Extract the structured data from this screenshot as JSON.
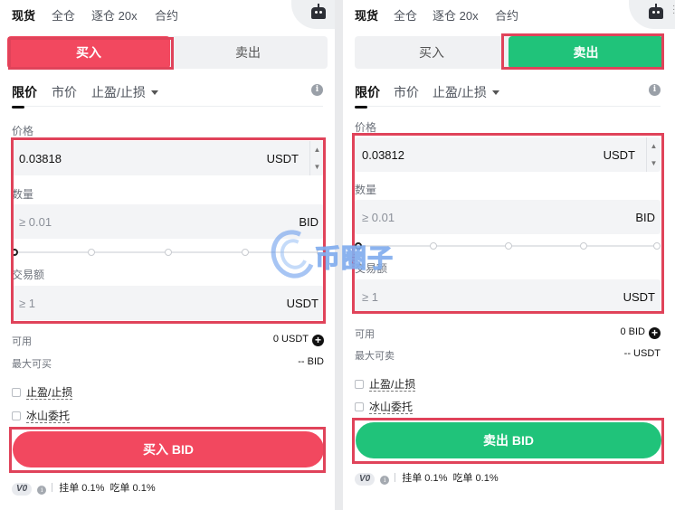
{
  "left": {
    "top_tabs": [
      "现货",
      "全仓",
      "逐仓 20x",
      "合约"
    ],
    "side": {
      "buy": "买入",
      "sell": "卖出",
      "active": "buy"
    },
    "order_tabs": {
      "limit": "限价",
      "market": "市价",
      "stop": "止盈/止损"
    },
    "price": {
      "label": "价格",
      "value": "0.03818",
      "unit": "USDT"
    },
    "amount": {
      "label": "数量",
      "placeholder": "≥ 0.01",
      "unit": "BID"
    },
    "slider_percent": 0,
    "total": {
      "label": "交易额",
      "placeholder": "≥ 1",
      "unit": "USDT"
    },
    "available": {
      "label": "可用",
      "value": "0 USDT"
    },
    "max": {
      "label": "最大可买",
      "value": "-- BID"
    },
    "checkbox_tpsl": "止盈/止损",
    "checkbox_iceberg": "冰山委托",
    "submit": "买入 BID",
    "fee": {
      "vip": "V0",
      "maker": "挂单 0.1%",
      "taker": "吃单 0.1%"
    }
  },
  "right": {
    "top_tabs": [
      "现货",
      "全仓",
      "逐仓 20x",
      "合约"
    ],
    "side": {
      "buy": "买入",
      "sell": "卖出",
      "active": "sell"
    },
    "order_tabs": {
      "limit": "限价",
      "market": "市价",
      "stop": "止盈/止损"
    },
    "price": {
      "label": "价格",
      "value": "0.03812",
      "unit": "USDT"
    },
    "amount": {
      "label": "数量",
      "placeholder": "≥ 0.01",
      "unit": "BID"
    },
    "slider_percent": 0,
    "total": {
      "label": "交易额",
      "placeholder": "≥ 1",
      "unit": "USDT"
    },
    "available": {
      "label": "可用",
      "value": "0 BID"
    },
    "max": {
      "label": "最大可卖",
      "value": "-- USDT"
    },
    "checkbox_tpsl": "止盈/止损",
    "checkbox_iceberg": "冰山委托",
    "submit": "卖出 BID",
    "fee": {
      "vip": "V0",
      "maker": "挂单 0.1%",
      "taker": "吃单 0.1%"
    }
  },
  "watermark": "币圈子",
  "colors": {
    "buy": "#f2485f",
    "sell": "#20c37a",
    "highlight": "#e0435a"
  }
}
